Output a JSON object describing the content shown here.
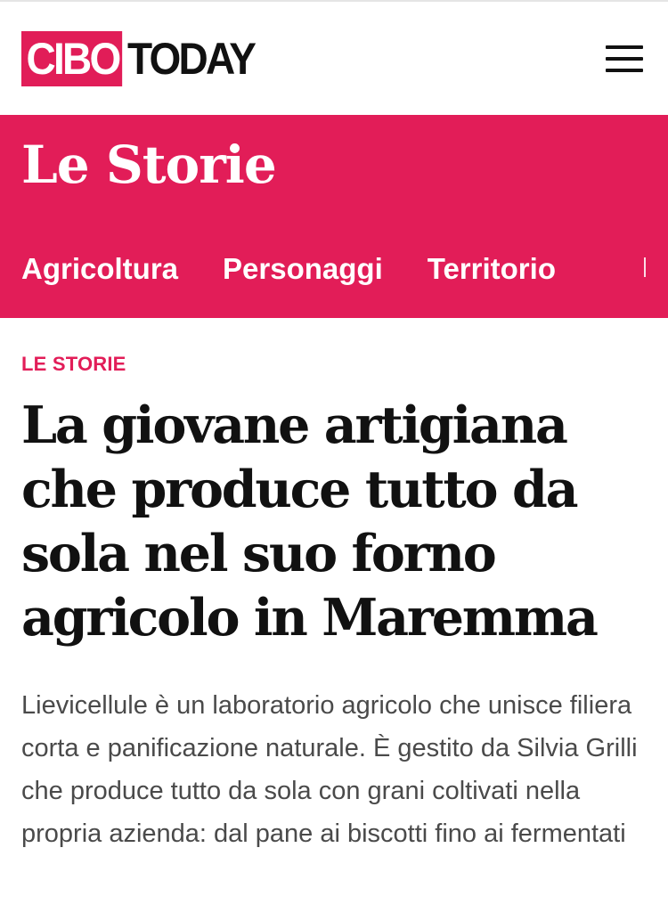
{
  "brand": {
    "logo_cibo": "CIBO",
    "logo_today": "TODAY",
    "accent_color": "#e21d58"
  },
  "header": {
    "menu_icon": "hamburger-menu-icon"
  },
  "section": {
    "title": "Le Storie",
    "subnav": [
      {
        "label": "Agricoltura"
      },
      {
        "label": "Personaggi"
      },
      {
        "label": "Territorio"
      }
    ]
  },
  "article": {
    "kicker": "LE STORIE",
    "headline": "La giovane artigiana che produce tutto da sola nel suo forno agricolo in Maremma",
    "summary": "Lievicellule è un laboratorio agricolo che unisce filiera corta e panificazione naturale. È gestito da Silvia Grilli che produce tutto da sola con grani coltivati nella propria azienda: dal pane ai biscotti fino ai fermentati"
  }
}
